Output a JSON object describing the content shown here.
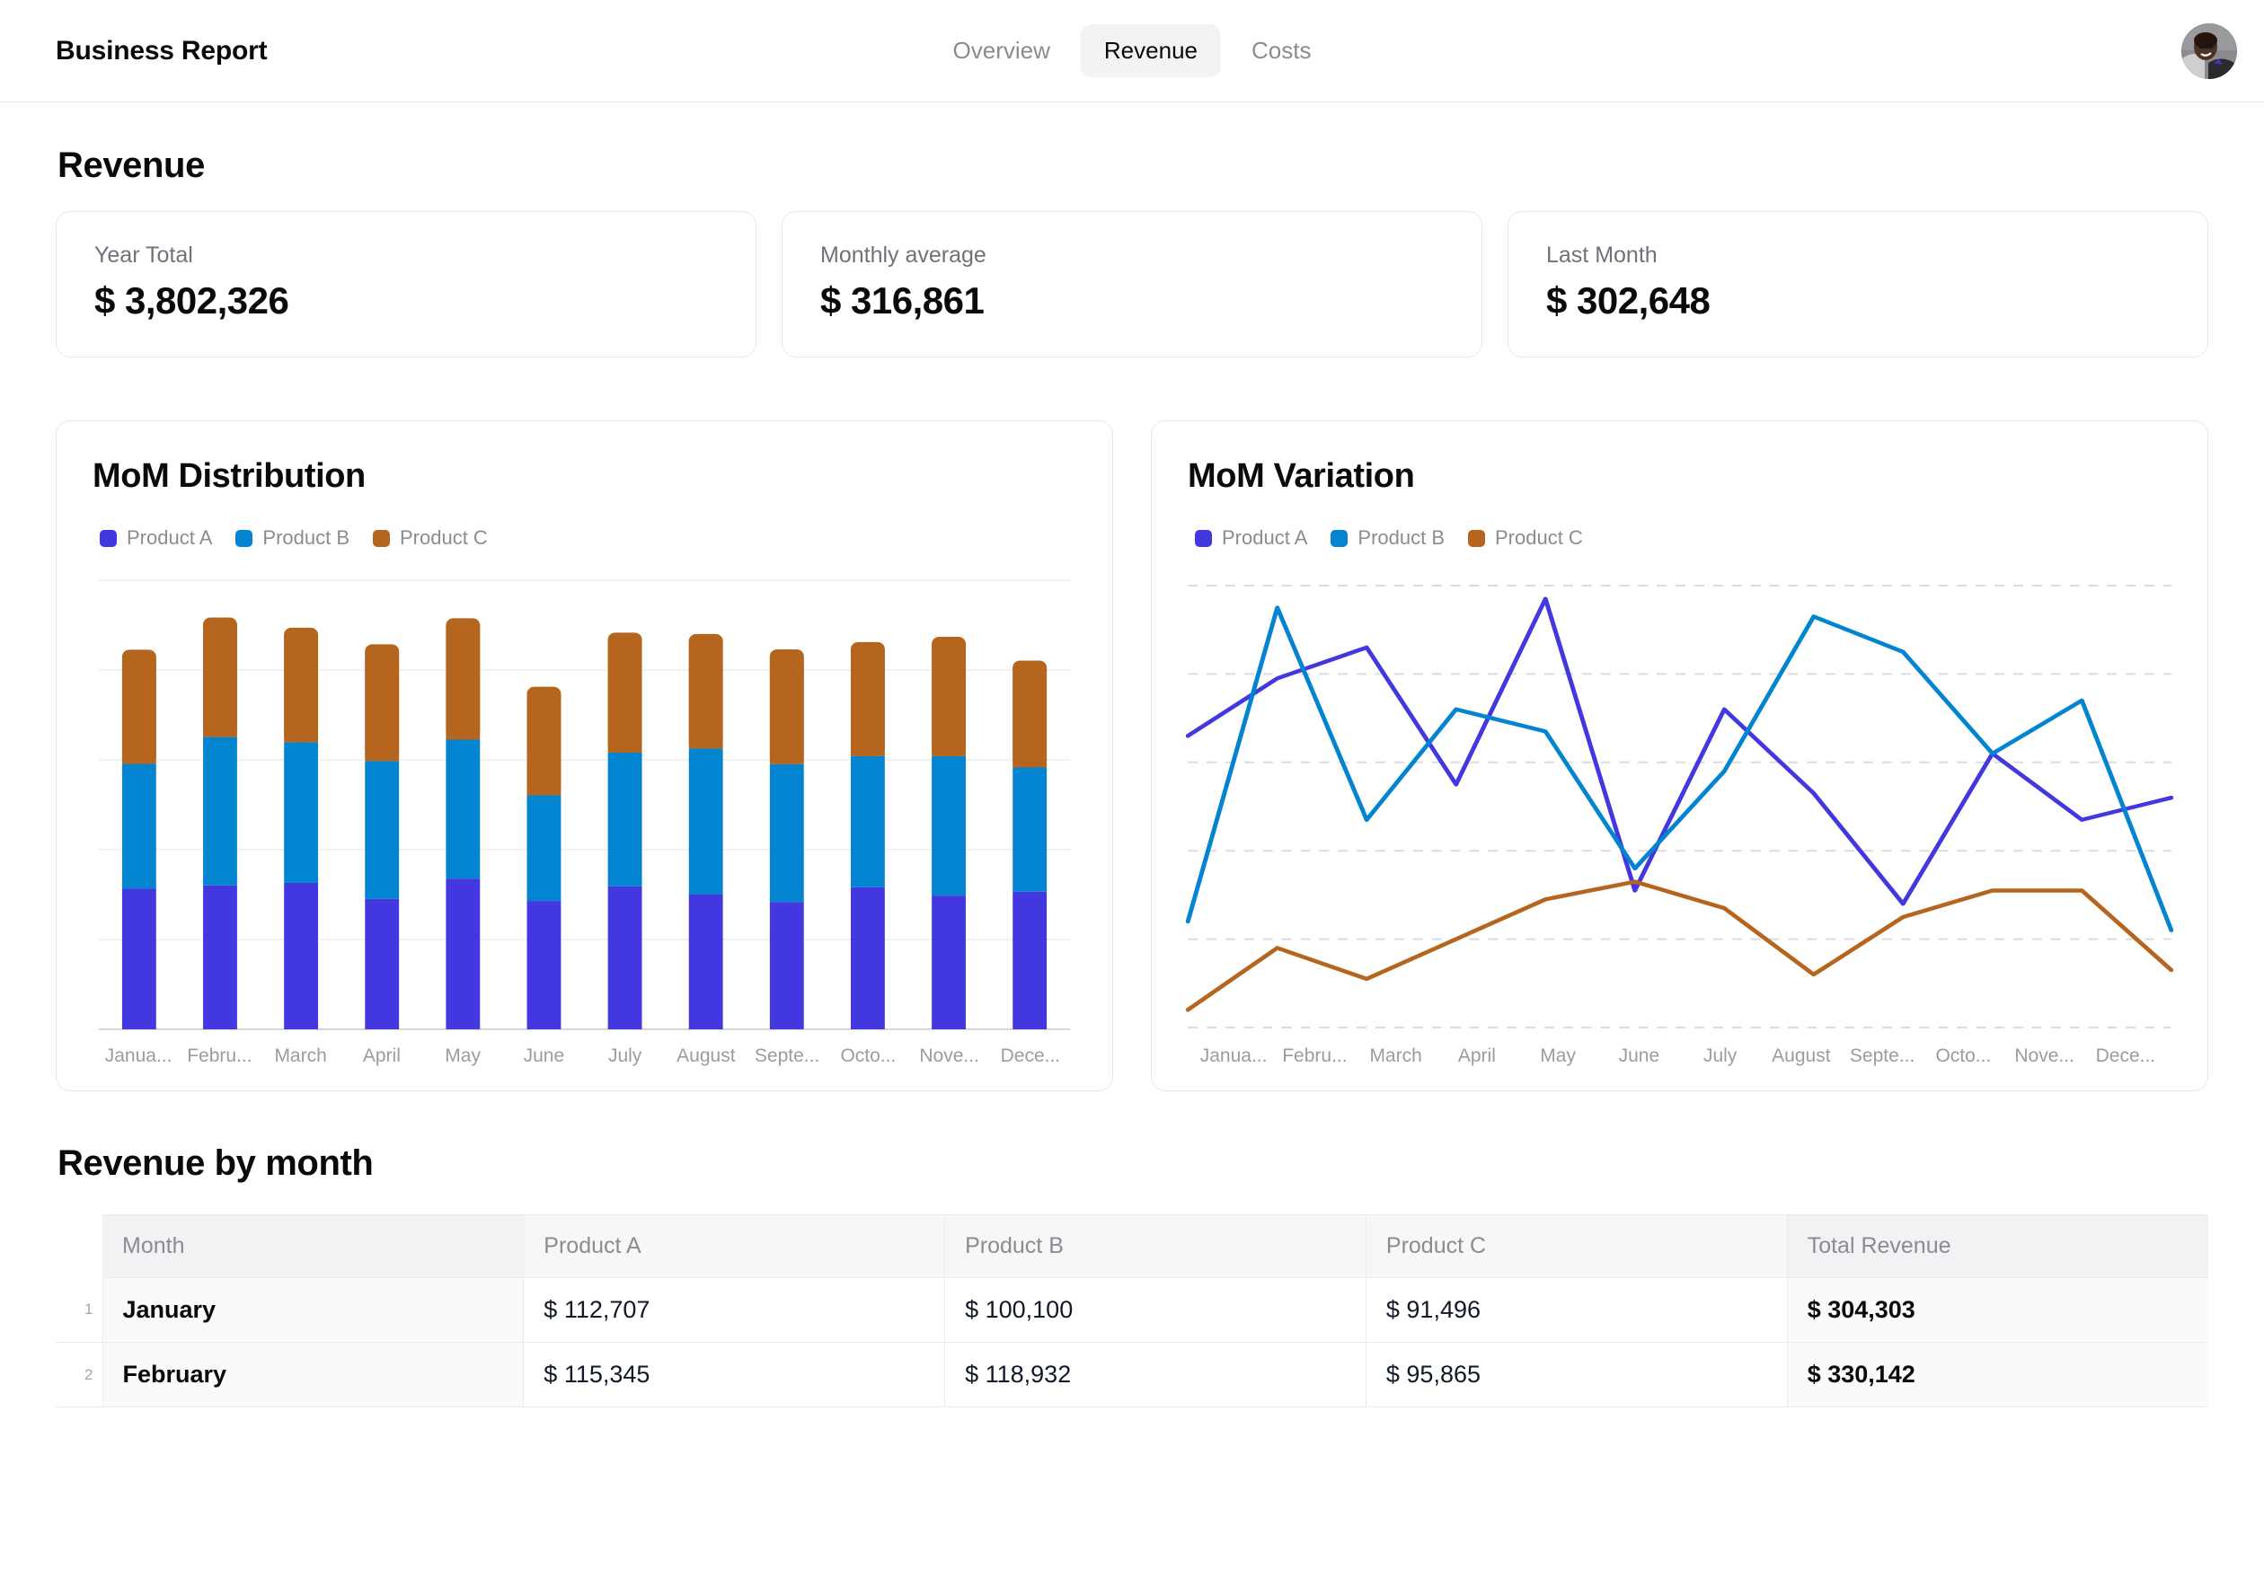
{
  "header": {
    "brand": "Business Report",
    "tabs": [
      {
        "label": "Overview",
        "active": false
      },
      {
        "label": "Revenue",
        "active": true
      },
      {
        "label": "Costs",
        "active": false
      }
    ],
    "avatar_name": "user-avatar"
  },
  "page": {
    "title": "Revenue",
    "section_title": "Revenue by month"
  },
  "kpis": [
    {
      "label": "Year Total",
      "value": "$ 3,802,326"
    },
    {
      "label": "Monthly average",
      "value": "$ 316,861"
    },
    {
      "label": "Last Month",
      "value": "$ 302,648"
    }
  ],
  "colors": {
    "product_a": "#4338e0",
    "product_b": "#0284d0",
    "product_c": "#b5651d",
    "grid": "#ededf0",
    "grid_dashed": "#dcdce0",
    "axis": "#d6d6db"
  },
  "charts": {
    "distribution": {
      "title": "MoM Distribution",
      "legend": [
        {
          "label": "Product A",
          "color": "#4338e0"
        },
        {
          "label": "Product B",
          "color": "#0284d0"
        },
        {
          "label": "Product C",
          "color": "#b5651d"
        }
      ],
      "xticks": [
        "Janua...",
        "Febru...",
        "March",
        "April",
        "May",
        "June",
        "July",
        "August",
        "Septe...",
        "Octo...",
        "Nove...",
        "Dece..."
      ]
    },
    "variation": {
      "title": "MoM Variation",
      "legend": [
        {
          "label": "Product A",
          "color": "#4338e0"
        },
        {
          "label": "Product B",
          "color": "#0284d0"
        },
        {
          "label": "Product C",
          "color": "#b5651d"
        }
      ],
      "xticks": [
        "Janua...",
        "Febru...",
        "March",
        "April",
        "May",
        "June",
        "July",
        "August",
        "Septe...",
        "Octo...",
        "Nove...",
        "Dece..."
      ]
    }
  },
  "chart_data": [
    {
      "type": "bar",
      "id": "mom-distribution",
      "title": "MoM Distribution",
      "stacked": true,
      "xlabel": "",
      "ylabel": "",
      "grid": true,
      "legend_position": "top-left",
      "categories": [
        "January",
        "February",
        "March",
        "April",
        "May",
        "June",
        "July",
        "August",
        "September",
        "October",
        "November",
        "December"
      ],
      "ylim": [
        0,
        360000
      ],
      "series": [
        {
          "name": "Product A",
          "color": "#4338e0",
          "values": [
            112707,
            115345,
            117400,
            104500,
            120800,
            102900,
            114600,
            108300,
            102100,
            113900,
            107200,
            110300
          ]
        },
        {
          "name": "Product B",
          "color": "#0284d0",
          "values": [
            100100,
            118932,
            112800,
            110600,
            111400,
            84700,
            107200,
            116800,
            110500,
            105100,
            111800,
            99600
          ]
        },
        {
          "name": "Product C",
          "color": "#b5651d",
          "values": [
            91496,
            95865,
            91700,
            93500,
            97300,
            87000,
            96200,
            91800,
            92000,
            91400,
            95600,
            85700
          ]
        }
      ]
    },
    {
      "type": "line",
      "id": "mom-variation",
      "title": "MoM Variation",
      "xlabel": "",
      "ylabel": "",
      "grid": true,
      "grid_style": "dashed",
      "legend_position": "top-left",
      "categories": [
        "January",
        "February",
        "March",
        "April",
        "May",
        "June",
        "July",
        "August",
        "September",
        "October",
        "November",
        "December"
      ],
      "ylim": [
        0,
        100
      ],
      "series": [
        {
          "name": "Product A",
          "color": "#4338e0",
          "values": [
            66,
            79,
            86,
            55,
            97,
            31,
            72,
            53,
            28,
            62,
            47,
            52
          ]
        },
        {
          "name": "Product B",
          "color": "#0284d0",
          "values": [
            24,
            95,
            47,
            72,
            67,
            36,
            58,
            93,
            85,
            62,
            74,
            22
          ]
        },
        {
          "name": "Product C",
          "color": "#b5651d",
          "values": [
            4,
            18,
            11,
            20,
            29,
            33,
            27,
            12,
            25,
            31,
            31,
            13
          ]
        }
      ]
    }
  ],
  "table": {
    "columns": [
      "Month",
      "Product A",
      "Product B",
      "Product C",
      "Total Revenue"
    ],
    "rows": [
      {
        "n": "1",
        "month": "January",
        "a": "$ 112,707",
        "b": "$ 100,100",
        "c": "$ 91,496",
        "total": "$ 304,303"
      },
      {
        "n": "2",
        "month": "February",
        "a": "$ 115,345",
        "b": "$ 118,932",
        "c": "$ 95,865",
        "total": "$ 330,142"
      }
    ]
  }
}
